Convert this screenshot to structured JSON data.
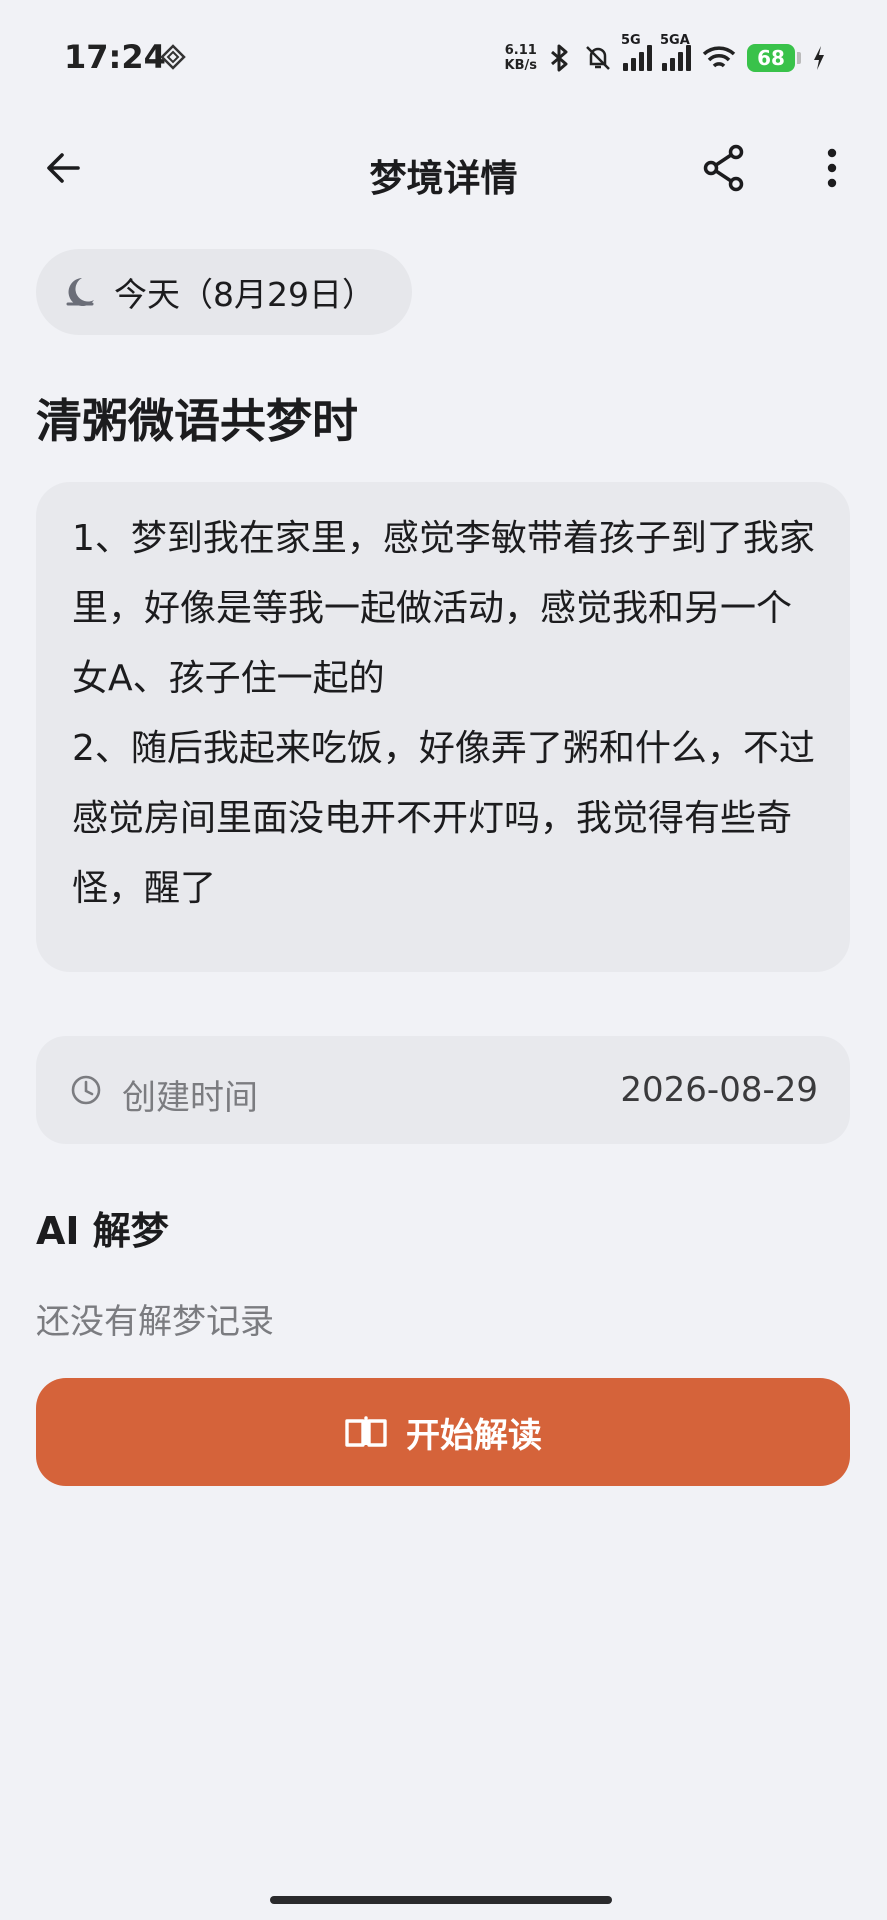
{
  "status_bar": {
    "time": "17:24",
    "net_speed_value": "6.11",
    "net_speed_unit": "KB/s",
    "signal1_label": "5G",
    "signal2_label": "5GA",
    "battery": "68"
  },
  "app_bar": {
    "title": "梦境详情",
    "back_icon": "arrow-left-icon",
    "share_icon": "share-icon",
    "more_icon": "more-vertical-icon"
  },
  "date_chip": {
    "icon": "moon-icon",
    "label": "今天（8月29日）"
  },
  "dream": {
    "title": "清粥微语共梦时",
    "content": "1、梦到我在家里，感觉李敏带着孩子到了我家里，好像是等我一起做活动，感觉我和另一个女A、孩子住一起的\n2、随后我起来吃饭，好像弄了粥和什么，不过感觉房间里面没电开不开灯吗，我觉得有些奇怪，醒了"
  },
  "meta": {
    "icon": "clock-icon",
    "created_label": "创建时间",
    "created_value": "2026-08-29"
  },
  "ai_section": {
    "title": "AI 解梦",
    "empty_text": "还没有解梦记录",
    "start_button_label": "开始解读",
    "start_button_icon": "book-icon"
  },
  "colors": {
    "background": "#f1f2f6",
    "card": "#e8e9ed",
    "accent": "#d5633a",
    "battery": "#39c24a"
  }
}
